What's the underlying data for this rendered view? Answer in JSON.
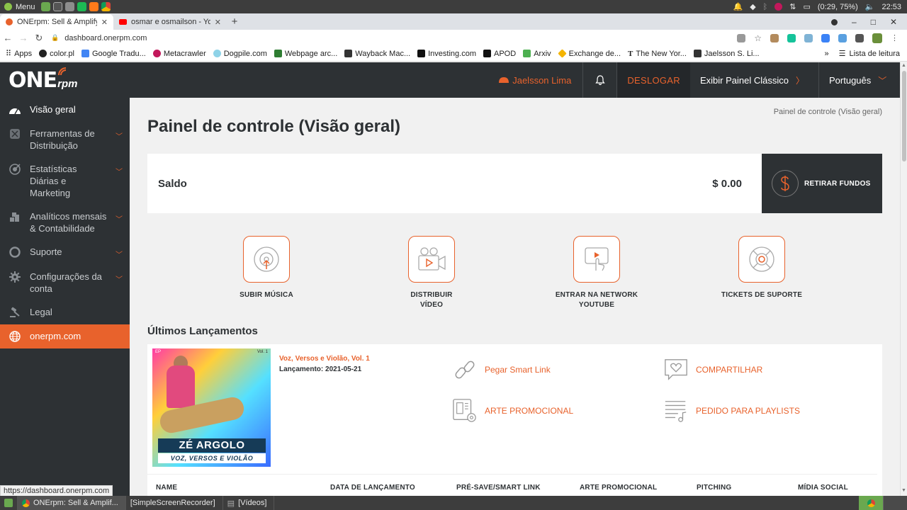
{
  "os": {
    "menu_label": "Menu",
    "battery": "(0:29, 75%)",
    "clock": "22:53"
  },
  "browser": {
    "tabs": [
      {
        "title": "ONErpm: Sell & Amplify",
        "active": true
      },
      {
        "title": "osmar e osmailson - You",
        "active": false
      }
    ],
    "url": "dashboard.onerpm.com",
    "bookmarks": [
      "Apps",
      "color.pl",
      "Google Tradu...",
      "Metacrawler",
      "Dogpile.com",
      "Webpage arc...",
      "Wayback Mac...",
      "Investing.com",
      "APOD",
      "Arxiv",
      "Exchange de...",
      "The New Yor...",
      "Jaelsson S. Li..."
    ],
    "bookmarks_more": "»",
    "reading_list": "Lista de leitura",
    "status_url": "https://dashboard.onerpm.com"
  },
  "header": {
    "logo_one": "ONE",
    "logo_rpm": "rpm",
    "user": "Jaelsson Lima",
    "logout": "DESLOGAR",
    "classic": "Exibir Painel Clássico",
    "language": "Português"
  },
  "sidebar": {
    "items": [
      {
        "label": "Visão geral",
        "caret": false
      },
      {
        "label": "Ferramentas de Distribuição",
        "caret": true
      },
      {
        "label": "Estatísticas Diárias e Marketing",
        "caret": true
      },
      {
        "label": "Analíticos mensais & Contabilidade",
        "caret": true
      },
      {
        "label": "Suporte",
        "caret": true
      },
      {
        "label": "Configurações da conta",
        "caret": true
      },
      {
        "label": "Legal",
        "caret": false
      },
      {
        "label": "onerpm.com",
        "caret": false
      }
    ]
  },
  "main": {
    "breadcrumb": "Painel de controle (Visão geral)",
    "title": "Painel de controle (Visão geral)",
    "balance_label": "Saldo",
    "balance_value": "$ 0.00",
    "withdraw": "RETIRAR FUNDOS",
    "actions": [
      {
        "label_1": "SUBIR MÚSICA",
        "label_2": ""
      },
      {
        "label_1": "DISTRIBUIR",
        "label_2": "VÍDEO"
      },
      {
        "label_1": "ENTRAR NA NETWORK",
        "label_2": "YOUTUBE"
      },
      {
        "label_1": "TICKETS DE SUPORTE",
        "label_2": ""
      }
    ],
    "latest_title": "Últimos Lançamentos",
    "release": {
      "cover_ep": "EP",
      "cover_vol": "Vol. 1",
      "cover_artist": "ZÉ ARGOLO",
      "cover_subtitle": "VOZ, VERSOS E VIOLÃO",
      "title": "Voz, Versos e Violão, Vol. 1",
      "date_label": "Lançamento:",
      "date_value": "2021-05-21",
      "links": {
        "smart_link": "Pegar Smart Link",
        "share": "COMPARTILHAR",
        "promo_art": "ARTE PROMOCIONAL",
        "playlist": "PEDIDO PARA PLAYLISTS"
      }
    },
    "table_headers": [
      "NAME",
      "DATA DE LANÇAMENTO",
      "PRÉ-SAVE/SMART LINK",
      "ARTE PROMOCIONAL",
      "PITCHING",
      "MÍDIA SOCIAL"
    ]
  },
  "taskbar": {
    "items": [
      "ONErpm: Sell & Amplif...",
      "[SimpleScreenRecorder]",
      "[Vídeos]"
    ]
  },
  "colors": {
    "accent": "#e8622c",
    "dark": "#2d3134",
    "background": "#f1f1f1"
  }
}
